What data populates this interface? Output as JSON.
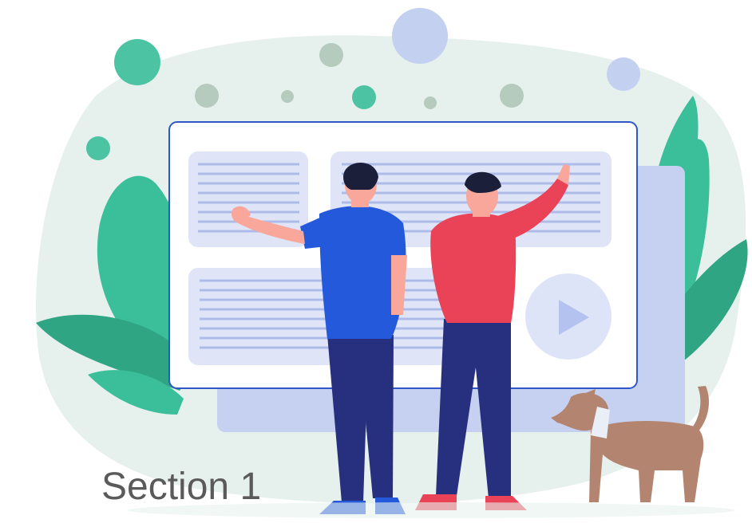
{
  "caption": {
    "text": "Section 1",
    "color": "#5a5a5a"
  },
  "palette": {
    "background": "#ffffff",
    "blob": "#e6f1ed",
    "leaf_green": "#3bbf9a",
    "leaf_dark": "#2fa583",
    "bubble_green": "#4cc4a4",
    "bubble_muted": "#b4cbbe",
    "bubble_lavender": "#c3d0f0",
    "window_border": "#2f57c9",
    "window_fill": "#ffffff",
    "back_window": "#c6d0f0",
    "panel_fill": "#dfe4f7",
    "panel_line": "#aebbe8",
    "play_circle": "#dde4f7",
    "play_icon": "#b3c2ef",
    "man_blue_shirt": "#2559db",
    "man_red_shirt": "#ea4256",
    "pants": "#27307e",
    "skin": "#f8a79a",
    "hair": "#1b1f3a",
    "shoes_blue": "#2559db",
    "shoes_red": "#ea4256",
    "dog_body": "#b38570",
    "dog_collar": "#e9eef7"
  },
  "icons": {
    "play": "play-icon",
    "leaf_left": "leaf-icon",
    "leaf_right": "leaf-icon",
    "dog": "dog-icon"
  }
}
